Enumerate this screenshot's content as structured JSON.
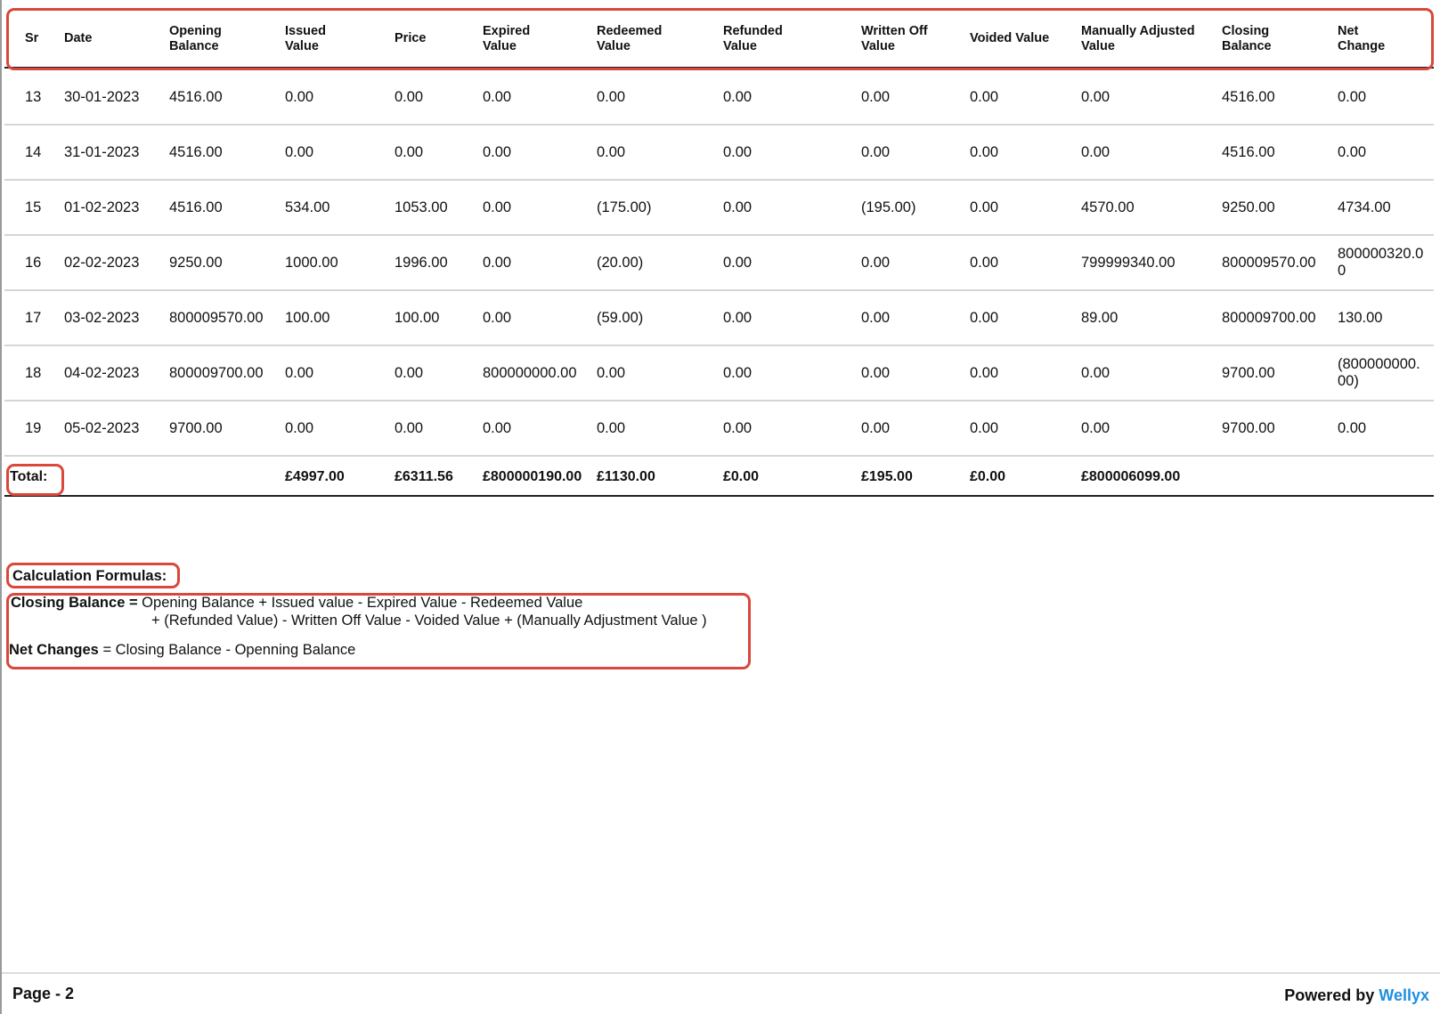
{
  "table": {
    "columns": [
      "Sr",
      "Date",
      "Opening\nBalance",
      "Issued\nValue",
      "Price",
      "Expired\nValue",
      "Redeemed\nValue",
      "Refunded\nValue",
      "Written Off\nValue",
      "Voided Value",
      "Manually Adjusted\nValue",
      "Closing\nBalance",
      "Net\nChange"
    ],
    "rows": [
      [
        "13",
        "30-01-2023",
        "4516.00",
        "0.00",
        "0.00",
        "0.00",
        "0.00",
        "0.00",
        "0.00",
        "0.00",
        "0.00",
        "4516.00",
        "0.00"
      ],
      [
        "14",
        "31-01-2023",
        "4516.00",
        "0.00",
        "0.00",
        "0.00",
        "0.00",
        "0.00",
        "0.00",
        "0.00",
        "0.00",
        "4516.00",
        "0.00"
      ],
      [
        "15",
        "01-02-2023",
        "4516.00",
        "534.00",
        "1053.00",
        "0.00",
        "(175.00)",
        "0.00",
        "(195.00)",
        "0.00",
        "4570.00",
        "9250.00",
        "4734.00"
      ],
      [
        "16",
        "02-02-2023",
        "9250.00",
        "1000.00",
        "1996.00",
        "0.00",
        "(20.00)",
        "0.00",
        "0.00",
        "0.00",
        "799999340.00",
        "800009570.00",
        "800000320.0\n0"
      ],
      [
        "17",
        "03-02-2023",
        "800009570.00",
        "100.00",
        "100.00",
        "0.00",
        "(59.00)",
        "0.00",
        "0.00",
        "0.00",
        "89.00",
        "800009700.00",
        "130.00"
      ],
      [
        "18",
        "04-02-2023",
        "800009700.00",
        "0.00",
        "0.00",
        "800000000.00",
        "0.00",
        "0.00",
        "0.00",
        "0.00",
        "0.00",
        "9700.00",
        "(800000000.\n00)"
      ],
      [
        "19",
        "05-02-2023",
        "9700.00",
        "0.00",
        "0.00",
        "0.00",
        "0.00",
        "0.00",
        "0.00",
        "0.00",
        "0.00",
        "9700.00",
        "0.00"
      ]
    ],
    "total": {
      "label": "Total:",
      "values": [
        "",
        "",
        "",
        "£4997.00",
        "£6311.56",
        "£800000190.00",
        "£1130.00",
        "£0.00",
        "£195.00",
        "£0.00",
        "£800006099.00",
        "",
        ""
      ]
    }
  },
  "formulas": {
    "title": "Calculation Formulas:",
    "closing_label": "Closing Balance =",
    "closing_line1": " Opening Balance + Issued value - Expired Value - Redeemed Value",
    "closing_line2": "+ (Refunded Value) - Written Off Value - Voided Value + (Manually Adjustment Value )",
    "net_label": "Net Changes",
    "net_text": " = Closing Balance - Openning Balance"
  },
  "footer": {
    "page": "Page - 2",
    "powered_prefix": "Powered by ",
    "brand": "Wellyx"
  },
  "colors": {
    "annotation_red": "#d9483b",
    "brand_blue": "#1e8fe0"
  }
}
